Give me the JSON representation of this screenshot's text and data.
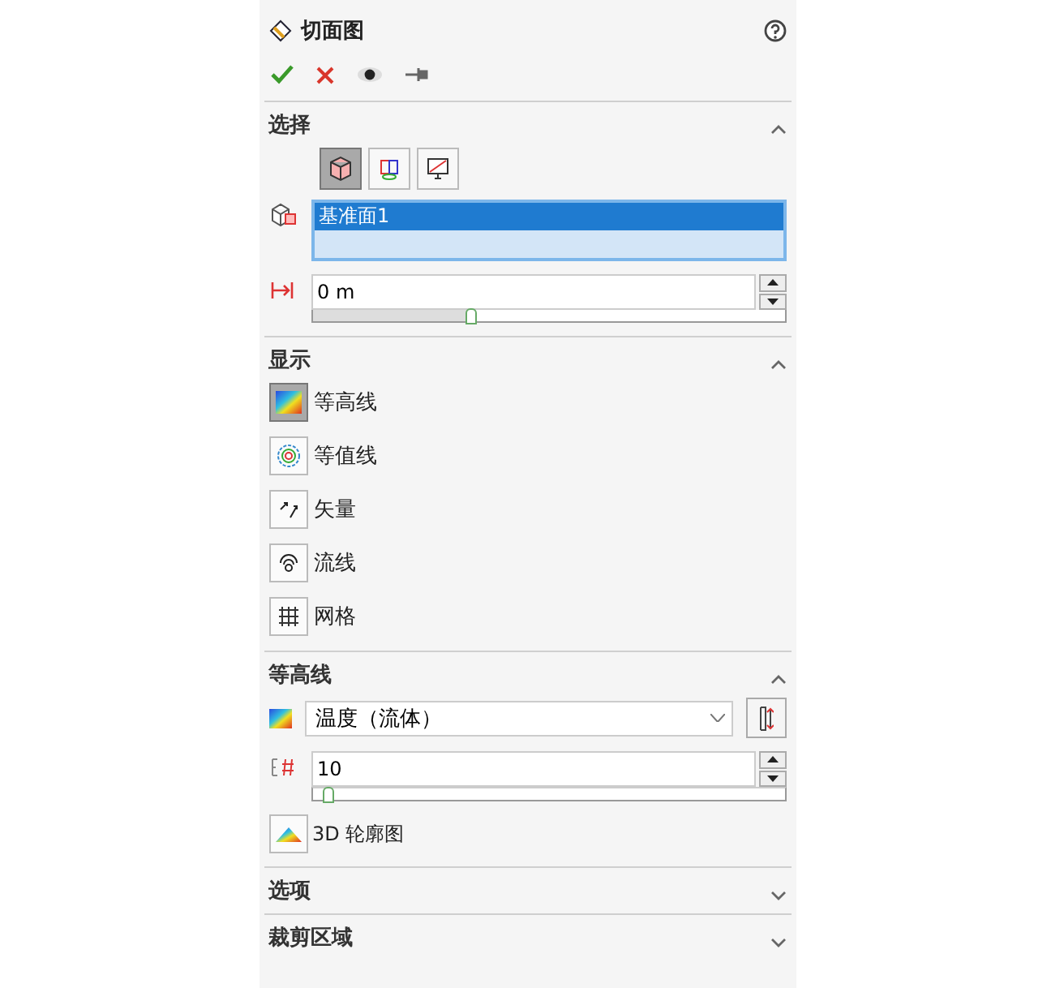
{
  "title": "切面图",
  "selection": {
    "title": "选择",
    "expanded": true,
    "tools": [
      {
        "kind": "body",
        "selected": true
      },
      {
        "kind": "components",
        "selected": false
      },
      {
        "kind": "screen",
        "selected": false
      }
    ],
    "items": [
      {
        "label": "基准面1",
        "selected": true
      }
    ],
    "offset": {
      "value": "0 m",
      "level": 0.33
    }
  },
  "display": {
    "title": "显示",
    "expanded": true,
    "modes": [
      {
        "kind": "contours",
        "label": "等高线",
        "selected": true
      },
      {
        "kind": "isolines",
        "label": "等值线",
        "selected": false
      },
      {
        "kind": "vectors",
        "label": "矢量",
        "selected": false
      },
      {
        "kind": "streamlines",
        "label": "流线",
        "selected": false
      },
      {
        "kind": "mesh",
        "label": "网格",
        "selected": false
      }
    ]
  },
  "contours": {
    "title": "等高线",
    "expanded": true,
    "parameter": "温度（流体）",
    "levels": {
      "value": "10",
      "level": 0.03
    },
    "button": "3D 轮廓图"
  },
  "collapsed": [
    {
      "title": "选项",
      "expanded": false
    },
    {
      "title": "裁剪区域",
      "expanded": false
    }
  ]
}
